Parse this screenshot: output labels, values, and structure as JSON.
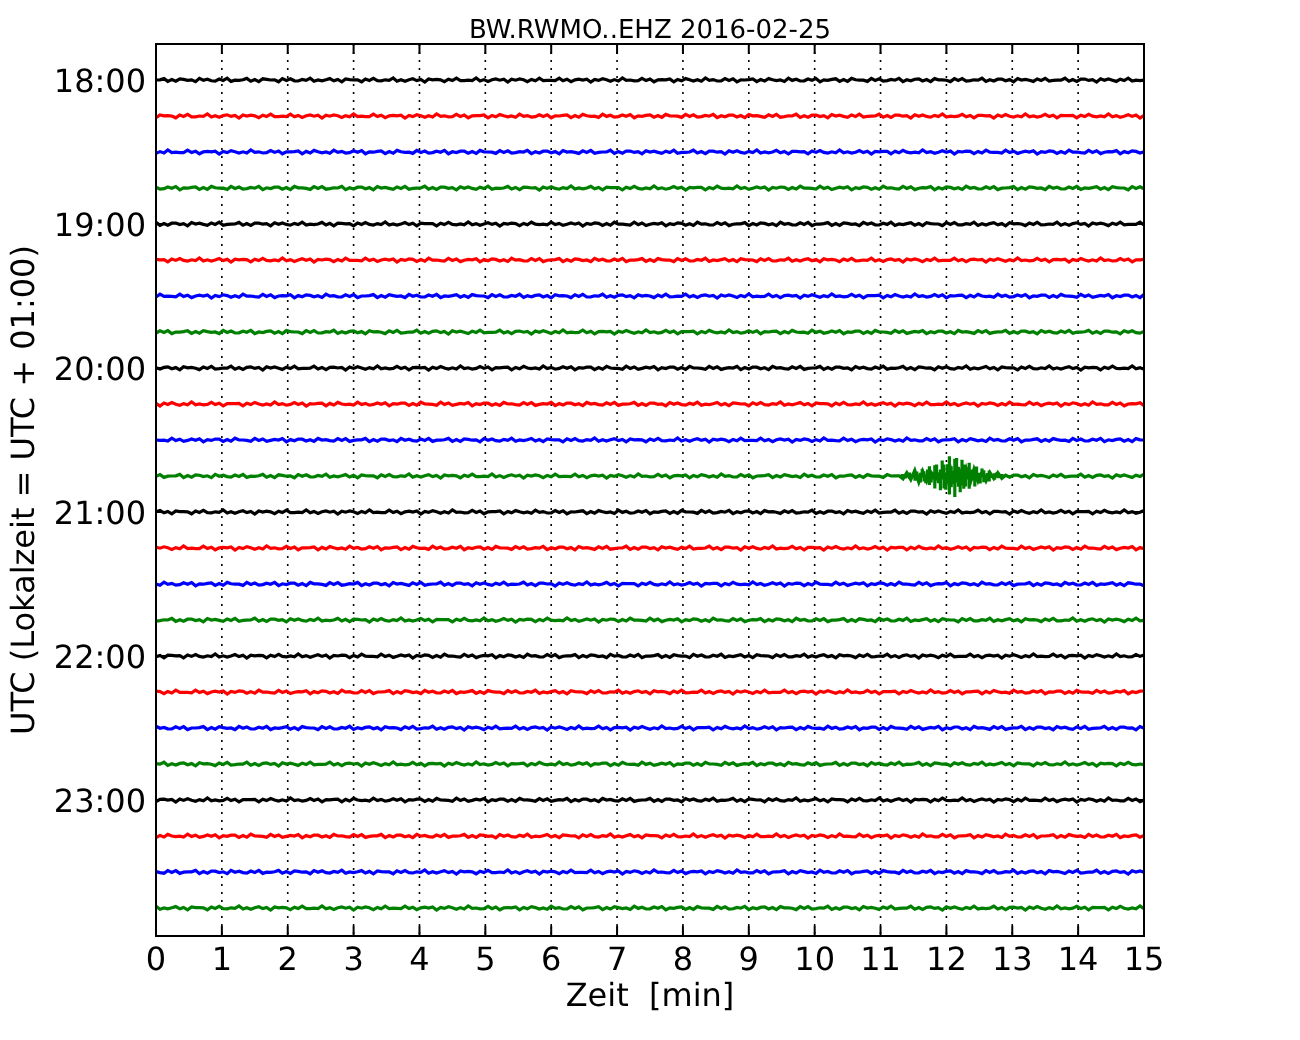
{
  "title": "BW.RWMO..EHZ 2016-02-25",
  "xlabel": "Zeit  [min]",
  "ylabel": "UTC (Lokalzeit = UTC + 01:00)",
  "xticks": [
    "0",
    "1",
    "2",
    "3",
    "4",
    "5",
    "6",
    "7",
    "8",
    "9",
    "10",
    "11",
    "12",
    "13",
    "14",
    "15"
  ],
  "yticks": [
    "18:00",
    "19:00",
    "20:00",
    "21:00",
    "22:00",
    "23:00"
  ],
  "traces": [
    {
      "color": "#000000",
      "event": false
    },
    {
      "color": "#ff0000",
      "event": false
    },
    {
      "color": "#0000ff",
      "event": false
    },
    {
      "color": "#008000",
      "event": false
    },
    {
      "color": "#000000",
      "event": false
    },
    {
      "color": "#ff0000",
      "event": false
    },
    {
      "color": "#0000ff",
      "event": false
    },
    {
      "color": "#008000",
      "event": false
    },
    {
      "color": "#000000",
      "event": false
    },
    {
      "color": "#ff0000",
      "event": false
    },
    {
      "color": "#0000ff",
      "event": false
    },
    {
      "color": "#008000",
      "event": true
    },
    {
      "color": "#000000",
      "event": false
    },
    {
      "color": "#ff0000",
      "event": false
    },
    {
      "color": "#0000ff",
      "event": false
    },
    {
      "color": "#008000",
      "event": false
    },
    {
      "color": "#000000",
      "event": false
    },
    {
      "color": "#ff0000",
      "event": false
    },
    {
      "color": "#0000ff",
      "event": false
    },
    {
      "color": "#008000",
      "event": false
    },
    {
      "color": "#000000",
      "event": false
    },
    {
      "color": "#ff0000",
      "event": false
    },
    {
      "color": "#0000ff",
      "event": false
    },
    {
      "color": "#008000",
      "event": false
    }
  ]
}
